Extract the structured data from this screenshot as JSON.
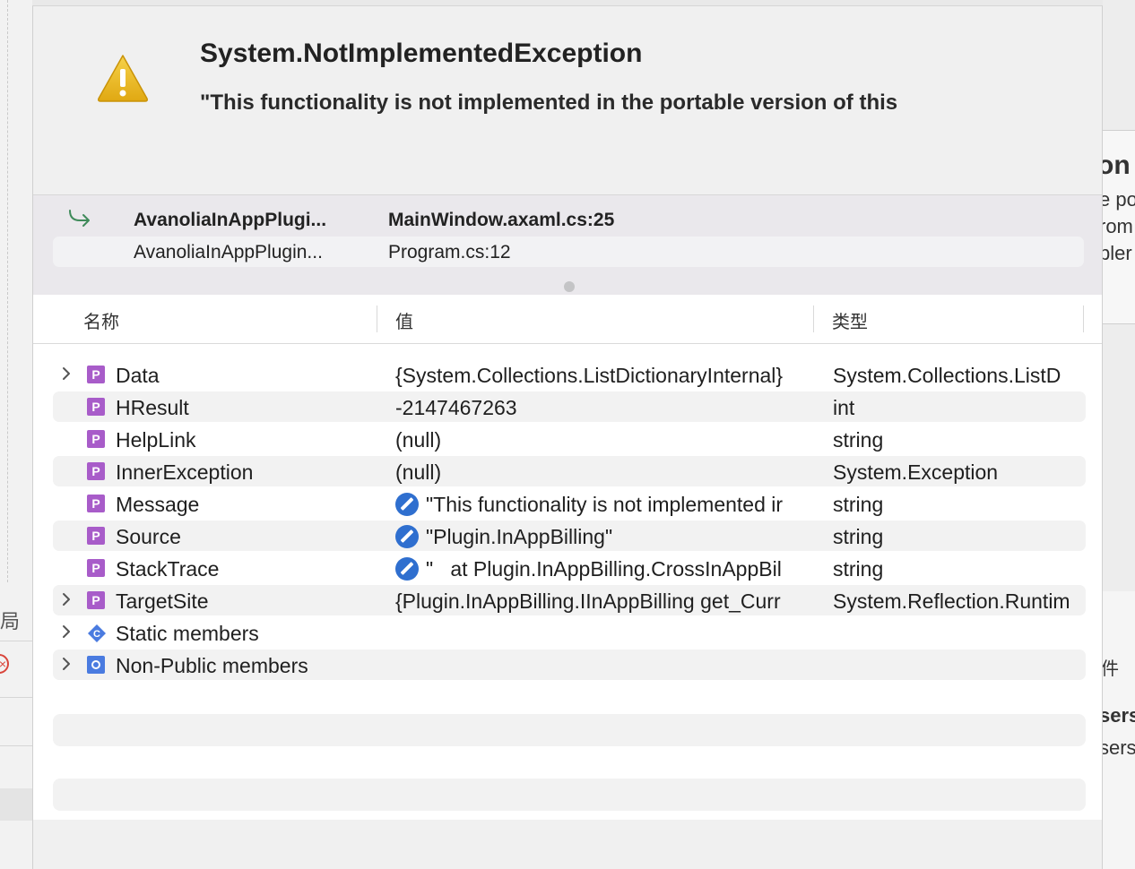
{
  "background": {
    "left_glyph": "局",
    "right_fragments": [
      "on",
      "e po",
      "rom",
      "pler",
      "件",
      "sers",
      "sers"
    ]
  },
  "dialog": {
    "icon": "warning-triangle-icon",
    "title": "System.NotImplementedException",
    "message": "\"This functionality is not implemented in the portable version of this"
  },
  "call_stack": {
    "frames": [
      {
        "function": "AvanoliaInAppPlugi...",
        "location": "MainWindow.axaml.cs:25",
        "current": true
      },
      {
        "function": "AvanoliaInAppPlugin...",
        "location": "Program.cs:12",
        "current": false
      }
    ]
  },
  "variables": {
    "columns": {
      "name": "名称",
      "value": "值",
      "type": "类型"
    },
    "rows": [
      {
        "name": "Data",
        "value": "{System.Collections.ListDictionaryInternal}",
        "type": "System.Collections.ListD",
        "kind": "P",
        "expandable": true,
        "editable": false
      },
      {
        "name": "HResult",
        "value": "-2147467263",
        "type": "int",
        "kind": "P",
        "expandable": false,
        "editable": false
      },
      {
        "name": "HelpLink",
        "value": "(null)",
        "type": "string",
        "kind": "P",
        "expandable": false,
        "editable": false
      },
      {
        "name": "InnerException",
        "value": "(null)",
        "type": "System.Exception",
        "kind": "P",
        "expandable": false,
        "editable": false
      },
      {
        "name": "Message",
        "value": "\"This functionality is not implemented ir",
        "type": "string",
        "kind": "P",
        "expandable": false,
        "editable": true
      },
      {
        "name": "Source",
        "value": "\"Plugin.InAppBilling\"",
        "type": "string",
        "kind": "P",
        "expandable": false,
        "editable": true
      },
      {
        "name": "StackTrace",
        "value": "\"   at Plugin.InAppBilling.CrossInAppBil",
        "type": "string",
        "kind": "P",
        "expandable": false,
        "editable": true
      },
      {
        "name": "TargetSite",
        "value": "{Plugin.InAppBilling.IInAppBilling get_Curr",
        "type": "System.Reflection.Runtim",
        "kind": "P",
        "expandable": true,
        "editable": false
      },
      {
        "name": "Static members",
        "value": "",
        "type": "",
        "kind": "C",
        "expandable": true,
        "editable": false
      },
      {
        "name": "Non-Public members",
        "value": "",
        "type": "",
        "kind": "O",
        "expandable": true,
        "editable": false
      }
    ]
  }
}
